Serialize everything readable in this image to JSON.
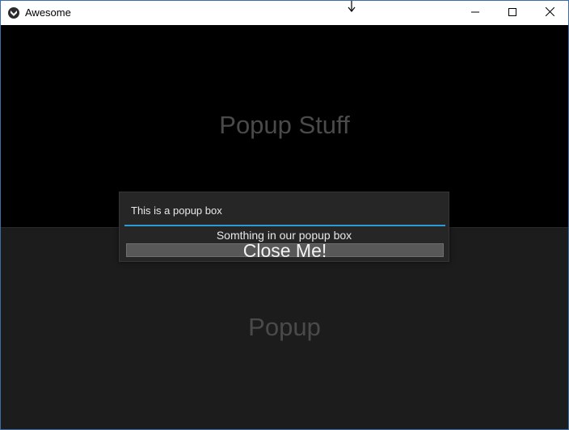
{
  "window": {
    "title": "Awesome",
    "icons": {
      "app": "kivy-logo-icon",
      "minimize": "minimize-icon",
      "maximize": "maximize-icon",
      "close": "close-icon"
    }
  },
  "main": {
    "top_label": "Popup Stuff",
    "bottom_label": "Popup"
  },
  "popup": {
    "title": "This is a popup box",
    "body": "Somthing in our popup box",
    "close_button": "Close Me!",
    "accent_color": "#2b9bd8"
  }
}
